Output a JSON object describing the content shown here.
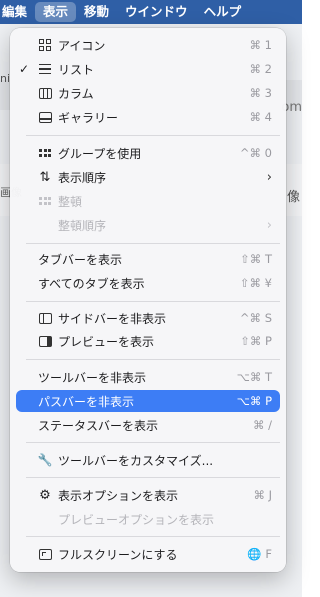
{
  "menubar": {
    "items": [
      {
        "label": "編集"
      },
      {
        "label": "表示"
      },
      {
        "label": "移動"
      },
      {
        "label": "ウインドウ"
      },
      {
        "label": "ヘルプ"
      }
    ]
  },
  "background": {
    "left_fragment": "ni",
    "right_fragment": "om",
    "left_fragment2": "画像",
    "right_fragment2": "像"
  },
  "menu": {
    "icon_view": {
      "label": "アイコン",
      "shortcut": "⌘ 1"
    },
    "list_view": {
      "label": "リスト",
      "shortcut": "⌘ 2",
      "check": "✓"
    },
    "column_view": {
      "label": "カラム",
      "shortcut": "⌘ 3"
    },
    "gallery_view": {
      "label": "ギャラリー",
      "shortcut": "⌘ 4"
    },
    "use_groups": {
      "label": "グループを使用",
      "shortcut": "^⌘ 0"
    },
    "sort_by": {
      "label": "表示順序",
      "chevron": "›"
    },
    "clean_up": {
      "label": "整頓"
    },
    "clean_up_by": {
      "label": "整頓順序",
      "chevron": "›"
    },
    "show_tab_bar": {
      "label": "タブバーを表示",
      "shortcut": "⇧⌘ T"
    },
    "show_all_tabs": {
      "label": "すべてのタブを表示",
      "shortcut": "⇧⌘ ¥"
    },
    "hide_sidebar": {
      "label": "サイドバーを非表示",
      "shortcut": "^⌘ S"
    },
    "show_preview": {
      "label": "プレビューを表示",
      "shortcut": "⇧⌘ P"
    },
    "hide_toolbar": {
      "label": "ツールバーを非表示",
      "shortcut": "⌥⌘ T"
    },
    "hide_path_bar": {
      "label": "パスバーを非表示",
      "shortcut": "⌥⌘ P"
    },
    "show_status_bar": {
      "label": "ステータスバーを表示",
      "shortcut": "⌘ /"
    },
    "customize_toolbar": {
      "label": "ツールバーをカスタマイズ..."
    },
    "show_view_options": {
      "label": "表示オプションを表示",
      "shortcut": "⌘ J"
    },
    "show_preview_options": {
      "label": "プレビューオプションを表示"
    },
    "enter_full_screen": {
      "label": "フルスクリーンにする",
      "shortcut": "🌐 F"
    }
  },
  "colors": {
    "menubar": "#2f5fa6",
    "highlight": "#3d7df5"
  }
}
